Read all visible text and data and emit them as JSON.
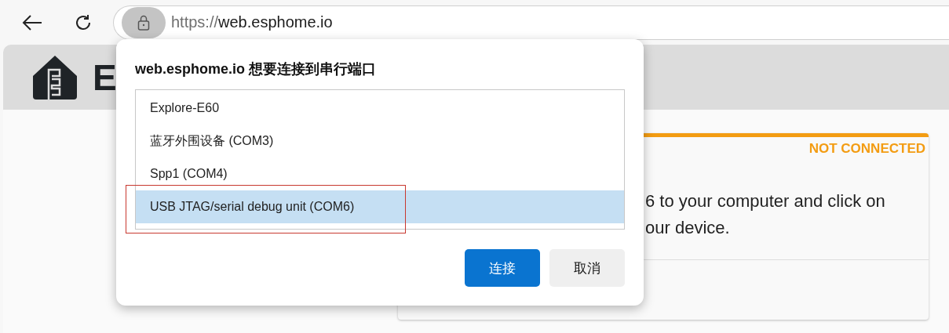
{
  "browser": {
    "url_scheme": "https://",
    "url_host": "web.esphome.io"
  },
  "page": {
    "header_title": "E",
    "card": {
      "status": "NOT CONNECTED",
      "text_lines": [
        "6 to your computer and click on",
        "our device."
      ]
    }
  },
  "dialog": {
    "title": "web.esphome.io 想要连接到串行端口",
    "ports": [
      {
        "label": "Explore-E60",
        "selected": false
      },
      {
        "label": "蓝牙外围设备 (COM3)",
        "selected": false
      },
      {
        "label": "Spp1 (COM4)",
        "selected": false
      },
      {
        "label": "USB JTAG/serial debug unit (COM6)",
        "selected": true
      }
    ],
    "buttons": [
      {
        "label": "连接",
        "kind": "primary"
      },
      {
        "label": "取消",
        "kind": "secondary"
      }
    ]
  }
}
